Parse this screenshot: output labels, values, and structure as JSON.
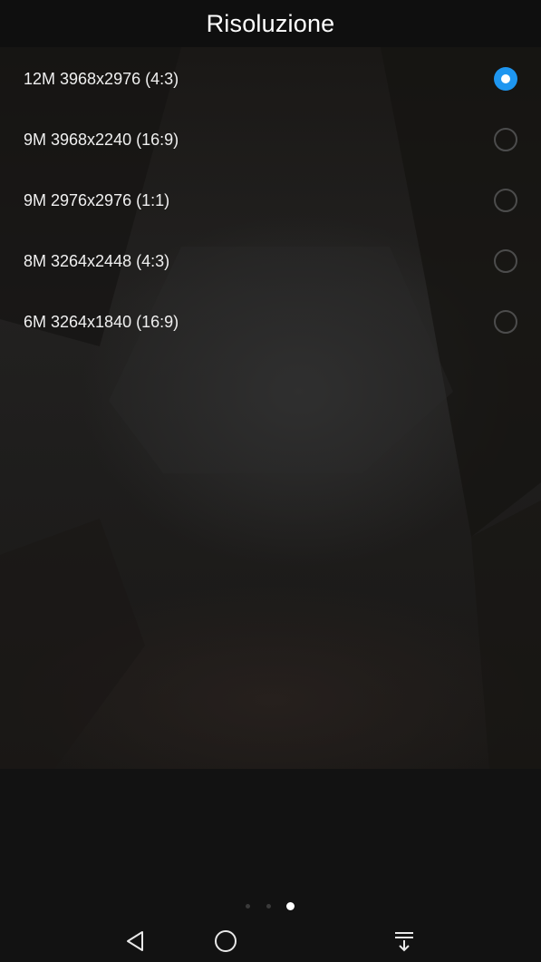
{
  "header": {
    "title": "Risoluzione"
  },
  "resolution_options": [
    {
      "label": "12M 3968x2976 (4:3)",
      "selected": true
    },
    {
      "label": "9M 3968x2240 (16:9)",
      "selected": false
    },
    {
      "label": "9M 2976x2976 (1:1)",
      "selected": false
    },
    {
      "label": "8M 3264x2448 (4:3)",
      "selected": false
    },
    {
      "label": "6M 3264x1840 (16:9)",
      "selected": false
    }
  ],
  "pager": {
    "page_count": 3,
    "active_page": 3
  },
  "nav_bar": {
    "buttons": [
      {
        "name": "back-button",
        "icon": "back-triangle-icon"
      },
      {
        "name": "home-button",
        "icon": "home-circle-icon"
      },
      {
        "name": "notifications-button",
        "icon": "pull-down-notifications-icon"
      }
    ]
  },
  "colors": {
    "accent": "#1e96f0",
    "background": "#121212",
    "text": "#ffffff"
  }
}
